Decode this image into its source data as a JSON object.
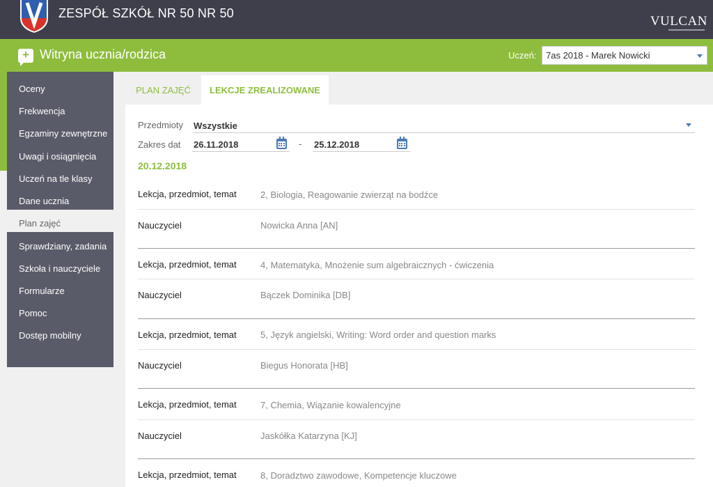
{
  "header": {
    "school_name": "ZESPÓŁ SZKÓŁ NR 50 NR 50",
    "brand": "VULCAN"
  },
  "app_bar": {
    "title": "Witryna ucznia/rodzica",
    "student_label": "Uczeń:",
    "student_selected": "7as 2018 - Marek Nowicki"
  },
  "sidebar": {
    "items": [
      {
        "label": "Oceny",
        "active": false
      },
      {
        "label": "Frekwencja",
        "active": false
      },
      {
        "label": "Egzaminy zewnętrzne",
        "active": false
      },
      {
        "label": "Uwagi i osiągnięcia",
        "active": false
      },
      {
        "label": "Uczeń na tle klasy",
        "active": false
      },
      {
        "label": "Dane ucznia",
        "active": false
      },
      {
        "label": "Plan zajęć",
        "active": true
      },
      {
        "label": "Sprawdziany, zadania",
        "active": false
      },
      {
        "label": "Szkoła i nauczyciele",
        "active": false
      },
      {
        "label": "Formularze",
        "active": false
      },
      {
        "label": "Pomoc",
        "active": false
      },
      {
        "label": "Dostęp mobilny",
        "active": false
      }
    ]
  },
  "tabs": [
    {
      "label": "PLAN ZAJĘĆ",
      "active": false
    },
    {
      "label": "LEKCJE ZREALIZOWANE",
      "active": true
    }
  ],
  "filters": {
    "subjects_label": "Przedmioty",
    "subjects_value": "Wszystkie",
    "date_range_label": "Zakres dat",
    "date_from": "26.11.2018",
    "date_separator": "-",
    "date_to": "25.12.2018"
  },
  "day": {
    "date": "20.12.2018",
    "lesson_label": "Lekcja, przedmiot, temat",
    "teacher_label": "Nauczyciel",
    "lessons": [
      {
        "lesson": "2, Biologia, Reagowanie zwierząt na bodźce",
        "teacher": "Nowicka Anna [AN]"
      },
      {
        "lesson": "4, Matematyka, Mnożenie sum algebraicznych - ćwiczenia",
        "teacher": "Bączek Dominika [DB]"
      },
      {
        "lesson": "5, Język angielski, Writing: Word order and question marks",
        "teacher": "Biegus Honorata [HB]"
      },
      {
        "lesson": "7, Chemia, Wiązanie kowalencyjne",
        "teacher": "Jaskółka Katarzyna [KJ]"
      },
      {
        "lesson": "8, Doradztwo zawodowe, Kompetencje kluczowe",
        "teacher": ""
      }
    ]
  },
  "colors": {
    "header_bg": "#3e3f4b",
    "accent_green": "#8ebd3d",
    "sidebar_bg": "#5a5b68",
    "icon_blue": "#4a7ab5"
  }
}
